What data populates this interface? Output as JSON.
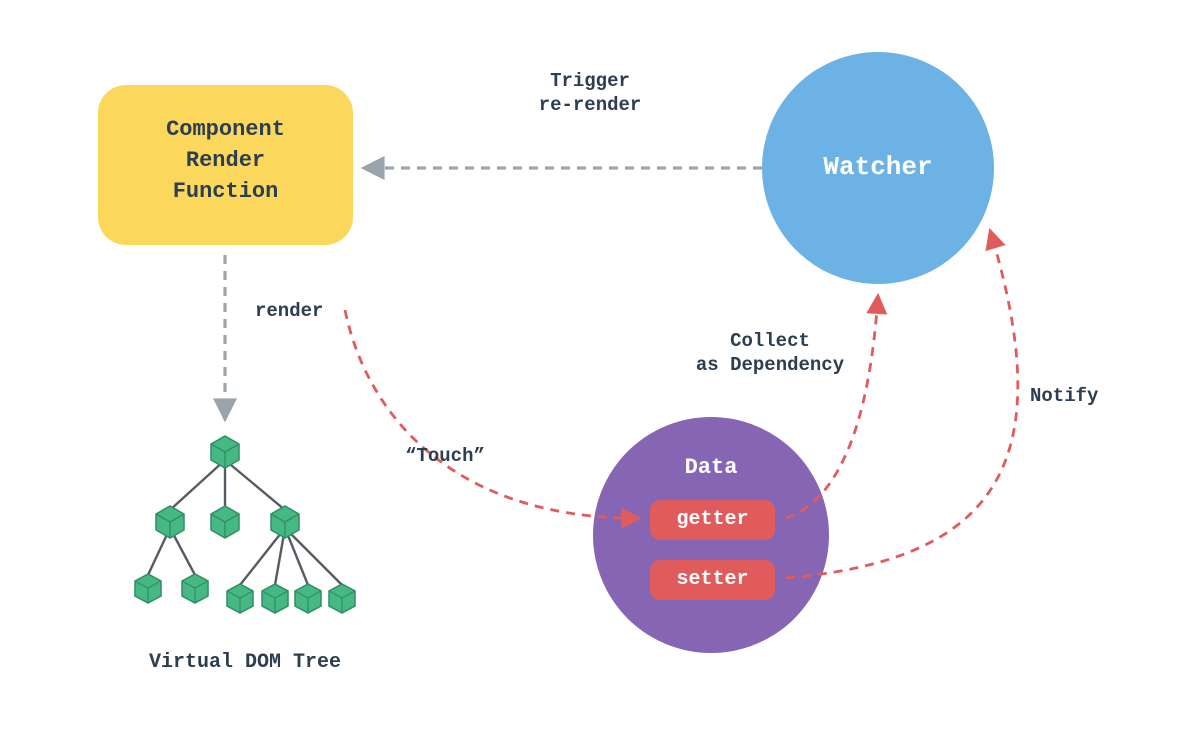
{
  "colors": {
    "yellow": "#fbd75b",
    "blue": "#6cb2e4",
    "purple": "#8665b5",
    "red": "#e05c5c",
    "green": "#45b884",
    "greenDark": "#2f8e63",
    "text": "#2c3e50",
    "gray": "#9aa4ad",
    "grayDash": "#9aa4ad",
    "redDash": "#e05c5c"
  },
  "nodes": {
    "renderFn": {
      "label": "Component\nRender\nFunction"
    },
    "watcher": {
      "label": "Watcher"
    },
    "data": {
      "label": "Data"
    },
    "getter": {
      "label": "getter"
    },
    "setter": {
      "label": "setter"
    },
    "vdomCaption": {
      "label": "Virtual DOM Tree"
    }
  },
  "arrows": {
    "trigger": {
      "label": "Trigger\nre-render"
    },
    "render": {
      "label": "render"
    },
    "touch": {
      "label": "“Touch”"
    },
    "collect": {
      "label": "Collect\nas Dependency"
    },
    "notify": {
      "label": "Notify"
    }
  }
}
